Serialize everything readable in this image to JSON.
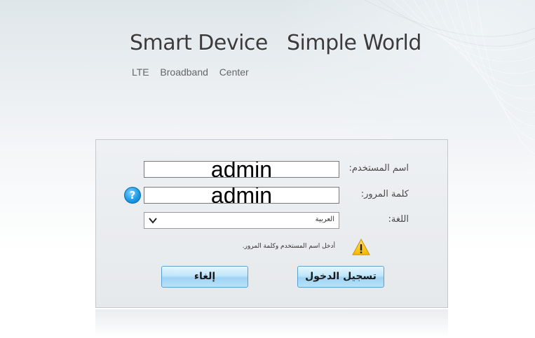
{
  "header": {
    "slogan": "Smart Device   Simple World",
    "subtitle": "LTE  Broadband  Center"
  },
  "login_form": {
    "username_label": "اسم المستخدم:",
    "username_value": "admin",
    "password_label": "كلمة المرور:",
    "password_value": "admin",
    "language_label": "اللغة:",
    "language_selected": "العربية",
    "hint": "أدخل اسم المستخدم وكلمة المرور.",
    "help_glyph": "?",
    "login_button": "تسجيل الدخول",
    "cancel_button": "إلغاء"
  },
  "icons": {
    "help": "question-mark-icon",
    "warning": "warning-triangle-icon",
    "dropdown": "chevron-down-icon"
  },
  "colors": {
    "accent_button": "#bfe5fa",
    "help_icon": "#1e9be3",
    "warning_icon": "#f5b800"
  }
}
